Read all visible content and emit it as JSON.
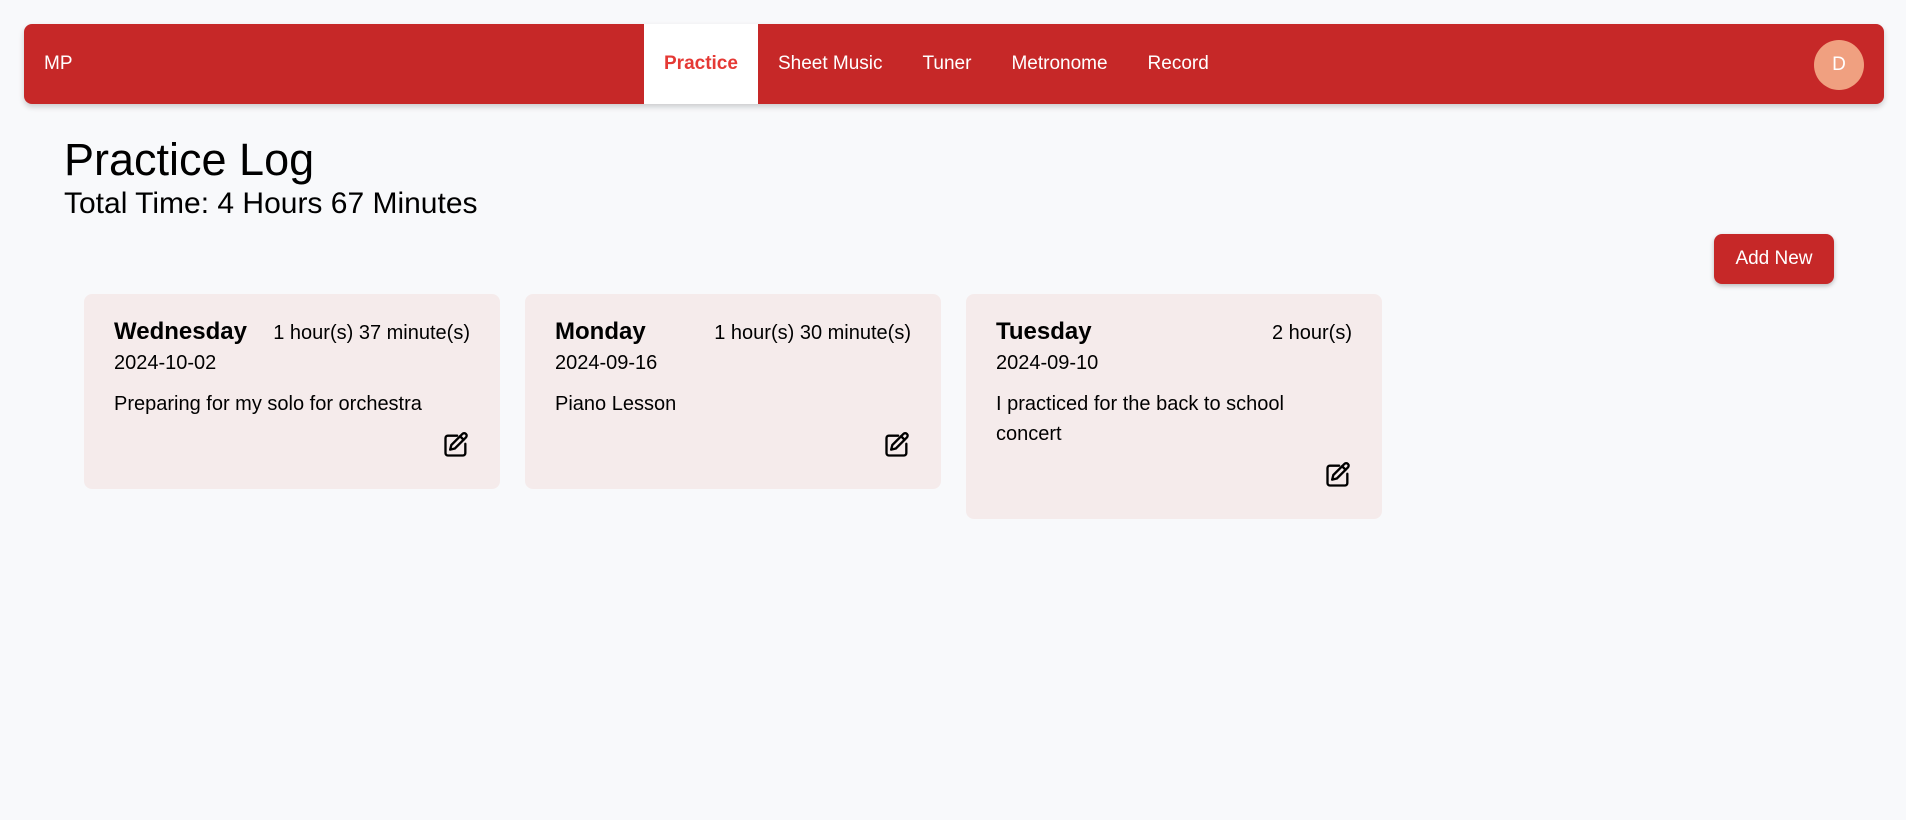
{
  "nav": {
    "brand": "MP",
    "links": [
      "Practice",
      "Sheet Music",
      "Tuner",
      "Metronome",
      "Record"
    ],
    "active_link": "Practice",
    "avatar_initial": "D"
  },
  "page": {
    "title": "Practice Log",
    "total_time": "Total Time: 4 Hours 67 Minutes",
    "add_button": "Add New"
  },
  "entries": [
    {
      "day": "Wednesday",
      "duration": "1 hour(s) 37 minute(s)",
      "date": "2024-10-02",
      "note": "Preparing for my solo for orchestra",
      "edit_icon": "edit-icon"
    },
    {
      "day": "Monday",
      "duration": "1 hour(s) 30 minute(s)",
      "date": "2024-09-16",
      "note": "Piano Lesson",
      "edit_icon": "edit-icon"
    },
    {
      "day": "Tuesday",
      "duration": "2 hour(s)",
      "date": "2024-09-10",
      "note": "I practiced for the back to school concert",
      "edit_icon": "edit-icon"
    }
  ],
  "colors": {
    "primary": "#c62828",
    "active_text": "#e53935",
    "avatar": "#f0a080",
    "card_bg": "#f5ebeb",
    "page_bg": "#f8f9fb"
  }
}
